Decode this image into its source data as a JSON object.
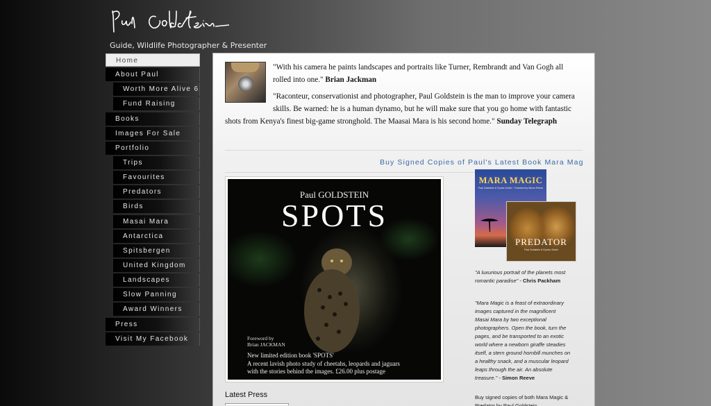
{
  "header": {
    "signature_text": "Paul Goldstein",
    "tagline": "Guide, Wildlife Photographer & Presenter"
  },
  "nav": {
    "items": [
      {
        "label": "Home",
        "active": true,
        "sub": false
      },
      {
        "label": "About Paul",
        "sub": false
      },
      {
        "label": "Worth More Alive 6",
        "sub": true
      },
      {
        "label": "Fund Raising",
        "sub": true
      },
      {
        "label": "Books",
        "sub": false
      },
      {
        "label": "Images For Sale",
        "sub": false
      },
      {
        "label": "Portfolio",
        "sub": false
      },
      {
        "label": "Trips",
        "sub": true
      },
      {
        "label": "Favourites",
        "sub": true
      },
      {
        "label": "Predators",
        "sub": true
      },
      {
        "label": "Birds",
        "sub": true
      },
      {
        "label": "Masai Mara",
        "sub": true
      },
      {
        "label": "Antarctica",
        "sub": true
      },
      {
        "label": "Spitsbergen",
        "sub": true
      },
      {
        "label": "United Kingdom",
        "sub": true
      },
      {
        "label": "Landscapes",
        "sub": true
      },
      {
        "label": "Slow Panning",
        "sub": true
      },
      {
        "label": "Award Winners",
        "sub": true
      },
      {
        "label": "Press",
        "sub": false
      },
      {
        "label": "Visit My Facebook",
        "sub": false
      }
    ]
  },
  "quotes": {
    "q1_text": "\"With his camera he paints landscapes and portraits like Turner, Rembrandt and Van Gogh all rolled into one.\"",
    "q1_author": "Brian Jackman",
    "q2_text": "\"Raconteur, conservationist and photographer, Paul Goldstein is the man to improve your camera skills. Be warned: he is a human dynamo, but he will make sure that you go home with fantastic shots from Kenya's finest big-game stronghold. The Maasai Mara is his second home.\"",
    "q2_author": "Sunday Telegraph"
  },
  "buy_link": "Buy Signed Copies of Paul's Latest Book Mara Mag",
  "spots_book": {
    "author": "Paul GOLDSTEIN",
    "title": "SPOTS",
    "foreword_label": "Foreword by",
    "foreword_name": "Brian JACKMAN",
    "caption_1": "New limited edition book 'SPOTS'",
    "caption_2": "A recent lavish photo study of cheetahs, leopards and jaguars",
    "caption_3": "with the stories behind the images.   £26.00 plus postage"
  },
  "mara_magic_book": {
    "title": "MARA MAGIC",
    "subtitle": "Paul Goldstein & Fyodor Zorkin · Foreword by Simon Reeve"
  },
  "predator_book": {
    "title": "PREDATOR",
    "subtitle": "Paul Goldstein & Fyodor Zorkin"
  },
  "reviews": {
    "r1_text": "\"A luxurious portrait of the planets most romantic paradise\" -",
    "r1_author": "Chris Packham",
    "r2_text": "\"Mara Magic is a feast of extraordinary images captured in the magnificent Masai Mara by two exceptional photographers. Open the book, turn the pages, and be transported to an exotic world where a newborn giraffe steadies itself, a stern ground hornbill munches on a healthy snack, and a muscular leopard leaps through the air. An absolute treasure.\" -",
    "r2_author": "Simon Reeve",
    "r3_text": "Buy signed copies of both Mara Magic & Predator by Paul Goldstein"
  },
  "latest_press": "Latest Press"
}
